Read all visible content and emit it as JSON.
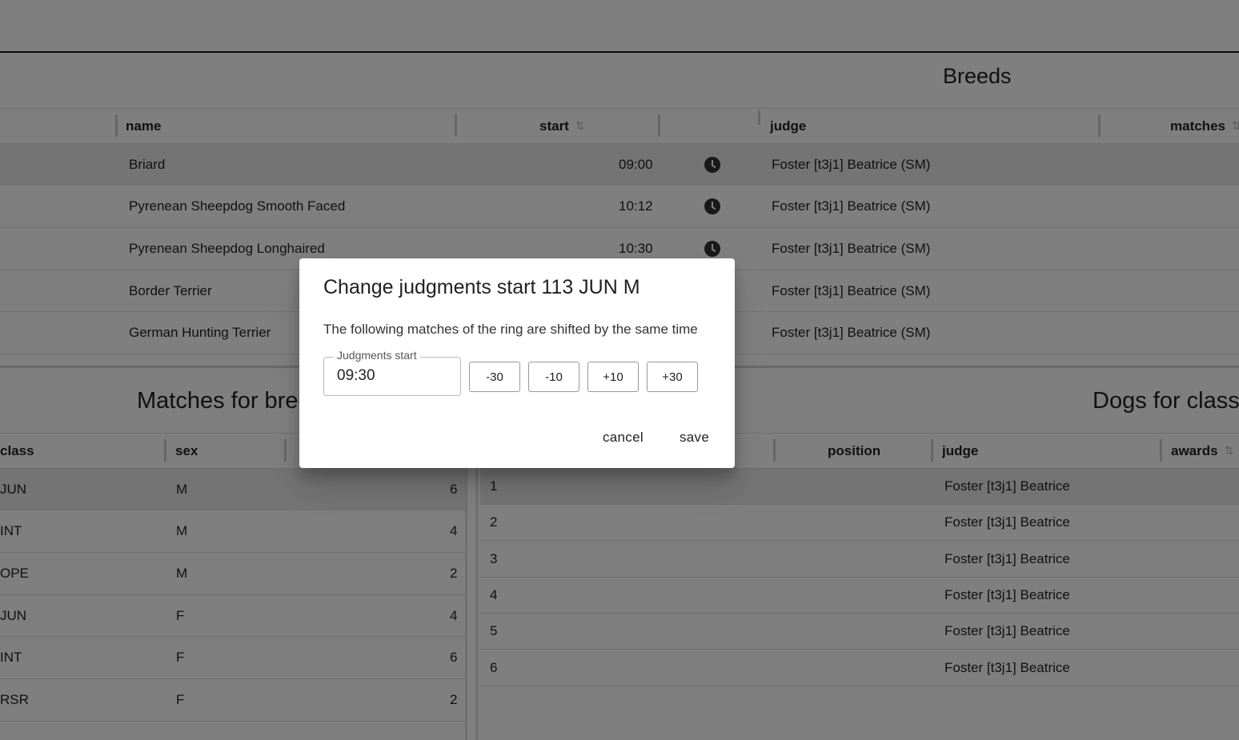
{
  "breeds": {
    "title": "Breeds",
    "columns": {
      "name": "name",
      "start": "start",
      "judge": "judge",
      "matches": "matches"
    },
    "rows": [
      {
        "name": "Briard",
        "start": "09:00",
        "judge": "Foster [t3j1] Beatrice (SM)"
      },
      {
        "name": "Pyrenean Sheepdog Smooth Faced",
        "start": "10:12",
        "judge": "Foster [t3j1] Beatrice (SM)"
      },
      {
        "name": "Pyrenean Sheepdog Longhaired",
        "start": "10:30",
        "judge": "Foster [t3j1] Beatrice (SM)"
      },
      {
        "name": "Border Terrier",
        "start": "",
        "judge": "Foster [t3j1] Beatrice (SM)"
      },
      {
        "name": "German Hunting Terrier",
        "start": "",
        "judge": "Foster [t3j1] Beatrice (SM)"
      }
    ]
  },
  "matches": {
    "title": "Matches for bree",
    "columns": {
      "class": "class",
      "sex": "sex"
    },
    "rows": [
      {
        "class": "JUN",
        "sex": "M",
        "count": "6"
      },
      {
        "class": "INT",
        "sex": "M",
        "count": "4"
      },
      {
        "class": "OPE",
        "sex": "M",
        "count": "2"
      },
      {
        "class": "JUN",
        "sex": "F",
        "count": "4"
      },
      {
        "class": "INT",
        "sex": "F",
        "count": "6"
      },
      {
        "class": "RSR",
        "sex": "F",
        "count": "2"
      }
    ]
  },
  "dogs": {
    "title": "Dogs for class",
    "columns": {
      "position": "position",
      "judge": "judge",
      "awards": "awards"
    },
    "rows": [
      {
        "num": "1",
        "judge": "Foster [t3j1] Beatrice"
      },
      {
        "num": "2",
        "judge": "Foster [t3j1] Beatrice"
      },
      {
        "num": "3",
        "judge": "Foster [t3j1] Beatrice"
      },
      {
        "num": "4",
        "judge": "Foster [t3j1] Beatrice"
      },
      {
        "num": "5",
        "judge": "Foster [t3j1] Beatrice"
      },
      {
        "num": "6",
        "judge": "Foster [t3j1] Beatrice"
      }
    ]
  },
  "dialog": {
    "title": "Change judgments start 113 JUN M",
    "text": "The following matches of the ring are shifted by the same time",
    "field_label": "Judgments start",
    "field_value": "09:30",
    "buttons": [
      "-30",
      "-10",
      "+10",
      "+30"
    ],
    "cancel_label": "cancel",
    "save_label": "save"
  },
  "icons": {
    "clock": "clock-icon",
    "sort": "sort-icon"
  },
  "colors": {
    "overlay": "#000000",
    "selected_row": "#e8e8e8",
    "border": "#e0e0e0"
  }
}
